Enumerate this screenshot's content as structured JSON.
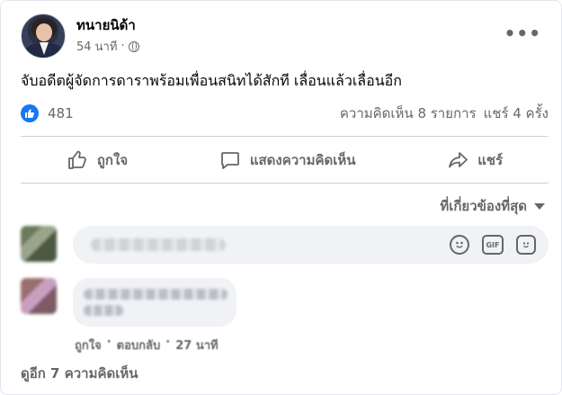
{
  "post": {
    "author": "ทนายนิด้า",
    "time": "54 นาที",
    "dot": "·",
    "text": "จับอดีตผู้จัดการดาราพร้อมเพื่อนสนิทได้สักที เลื่อนแล้วเลื่อนอีก",
    "privacy_icon": "globe-icon"
  },
  "stats": {
    "likes": "481",
    "comments": "ความคิดเห็น 8 รายการ",
    "shares": "แชร์ 4 ครั้ง"
  },
  "actions": {
    "like": "ถูกใจ",
    "comment": "แสดงความคิดเห็น",
    "share": "แชร์"
  },
  "sort": {
    "label": "ที่เกี่ยวข้องที่สุด"
  },
  "comment_input": {
    "icons": [
      "emoji-icon",
      "gif-icon",
      "sticker-icon"
    ],
    "gif_label": "GIF"
  },
  "reply": {
    "like": "ถูกใจ",
    "reply": "ตอบกลับ",
    "time": "27 นาที",
    "dot": "·"
  },
  "see_more": "ดูอีก 7 ความคิดเห็น",
  "colors": {
    "accent": "#1877f2",
    "muted_text": "#65676b",
    "input_bg": "#f0f2f5"
  }
}
